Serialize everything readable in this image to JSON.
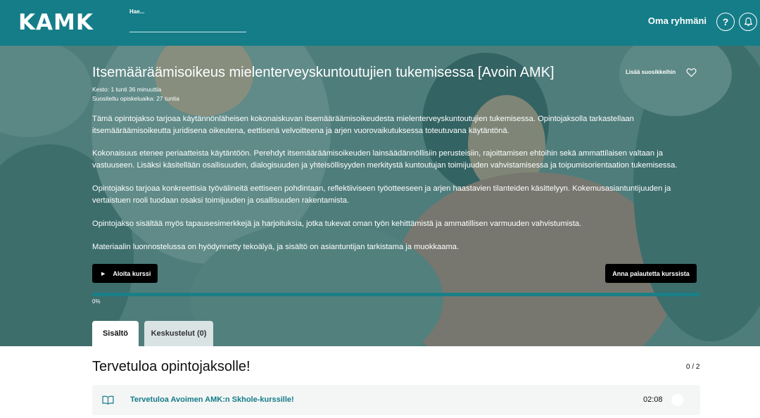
{
  "header": {
    "logo": "KAMK",
    "search_label": "Hae...",
    "group_link": "Oma ryhmäni",
    "help_symbol": "?",
    "icons": [
      "help-icon",
      "bell-icon"
    ]
  },
  "course": {
    "title": "Itsemääräämisoikeus mielenterveyskuntoutujien tukemisessa [Avoin AMK]",
    "favorite_label": "Lisää suosikkeihin",
    "duration": "Kesto: 1 tunti 36 minuuttia",
    "study_time": "Suositeltu opiskeluaika: 27 tuntia",
    "description": [
      "Tämä opintojakso tarjoaa käytännönläheisen kokonaiskuvan itsemääräämisoikeudesta mielenterveyskuntoutujien tukemisessa. Opintojaksolla tarkastellaan itsemääräämisoikeutta juridisena oikeutena, eettisenä velvoitteena ja arjen vuorovaikutuksessa toteutuvana käytäntönä.",
      "Kokonaisuus etenee periaatteista käytäntöön. Perehdyt itsemääräämisoikeuden lainsäädännöllisiin perusteisiin, rajoittamisen ehtoihin sekä ammattilaisen valtaan ja vastuuseen. Lisäksi käsitellään osallisuuden, dialogisuuden ja yhteisöllisyyden merkitystä kuntoutujan toimijuuden vahvistamisessa ja toipumisorientaation tukemisessa.",
      "Opintojakso tarjoaa konkreettisia työvälineitä eettiseen pohdintaan, reflektiiviseen työotteeseen ja arjen haastavien tilanteiden käsittelyyn. Kokemusasiantuntijuuden ja vertaistuen rooli tuodaan osaksi toimijuuden ja osallisuuden rakentamista.",
      "Opintojakso sisältää myös tapausesimerkkejä ja harjoituksia, jotka tukevat oman työn kehittämistä ja ammatillisen varmuuden vahvistumista.",
      "Materiaalin luonnostelussa on hyödynnetty tekoälyä, ja sisältö on asiantuntijan tarkistama ja muokkaama."
    ],
    "start_label": "Aloita kurssi",
    "feedback_label": "Anna palautetta kurssista",
    "progress_fraction": 0,
    "progress_text": "0%"
  },
  "tabs": [
    {
      "label": "Sisältö",
      "active": true
    },
    {
      "label": "Keskustelut (0)",
      "active": false
    }
  ],
  "section": {
    "title": "Tervetuloa opintojaksolle!",
    "count": "0 / 2",
    "lessons": [
      {
        "title": "Tervetuloa Avoimen AMK:n Skhole-kurssille!",
        "duration": "02:08"
      }
    ]
  },
  "colors": {
    "brand": "#147d88",
    "button_dark": "#000000",
    "row_background": "#f4f5f5"
  }
}
